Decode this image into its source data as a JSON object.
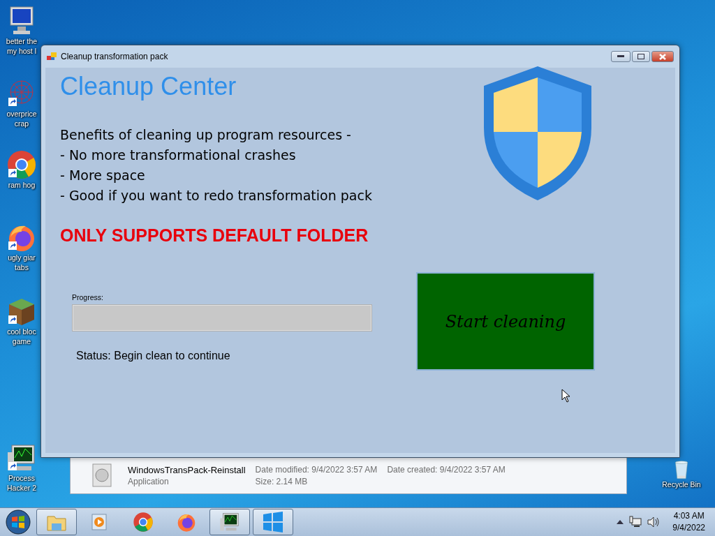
{
  "desktop_icons": [
    {
      "lines": [
        "better the",
        "my host l"
      ]
    },
    {
      "lines": [
        "overprice",
        "crap"
      ]
    },
    {
      "lines": [
        "ram hog"
      ]
    },
    {
      "lines": [
        "ugly giar",
        "tabs"
      ]
    },
    {
      "lines": [
        "cool bloc",
        "game"
      ]
    },
    {
      "lines": [
        "Process",
        "Hacker 2"
      ]
    },
    {
      "lines": [
        "Recycle Bin"
      ]
    }
  ],
  "details_pane": {
    "name": "WindowsTransPack-Reinstall",
    "type": "Application",
    "fields": [
      {
        "label": "Date modified:",
        "value": "9/4/2022 3:57 AM"
      },
      {
        "label": "Date created:",
        "value": "9/4/2022 3:57 AM"
      },
      {
        "label": "Size:",
        "value": "2.14 MB"
      }
    ]
  },
  "window": {
    "title": "Cleanup transformation pack",
    "heading": "Cleanup Center",
    "benefits": [
      "Benefits of cleaning up program resources -",
      "- No more transformational crashes",
      "- More space",
      "- Good if you want to redo transformation pack"
    ],
    "warning": "ONLY SUPPORTS DEFAULT FOLDER",
    "progress": {
      "label": "Progress:",
      "level": 0
    },
    "status": "Status: Begin clean to continue",
    "start_button": "Start cleaning"
  },
  "taskbar": {
    "items": [
      {
        "active": true
      },
      {
        "active": false
      },
      {
        "active": false
      },
      {
        "active": false
      },
      {
        "active": true
      },
      {
        "active": true
      }
    ],
    "time": "4:03 AM",
    "date": "9/4/2022"
  }
}
